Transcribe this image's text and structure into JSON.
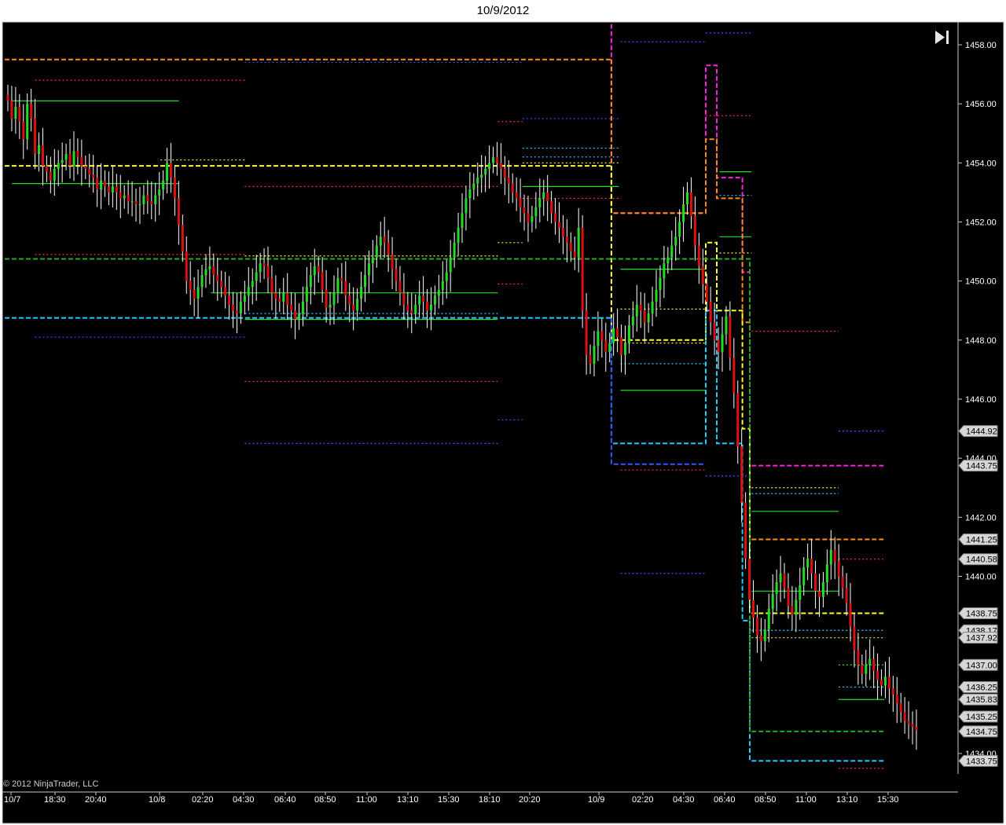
{
  "window": {
    "title": "10/9/2012"
  },
  "copyright": "© 2012 NinjaTrader, LLC",
  "chart_data": {
    "type": "candlestick",
    "title": "10/9/2012",
    "background": "#000000",
    "up_color": "#22dd22",
    "down_color": "#dd1111",
    "wick_color": "#ffffff",
    "ylim": [
      1433.0,
      1458.7
    ],
    "y_ticks": [
      "1458.00",
      "1456.00",
      "1454.00",
      "1452.00",
      "1450.00",
      "1448.00",
      "1446.00",
      "1444.00",
      "1442.00",
      "1440.00",
      "1434.00"
    ],
    "x_ticks": [
      "10/7",
      "18:30",
      "20:40",
      "10/8",
      "02:20",
      "04:30",
      "06:40",
      "08:50",
      "11:00",
      "13:10",
      "15:30",
      "18:10",
      "20:20",
      "10/9",
      "02:20",
      "04:30",
      "06:40",
      "08:50",
      "11:00",
      "13:10",
      "15:30"
    ],
    "price_markers": [
      {
        "label": "1444.92",
        "value": 1444.92
      },
      {
        "label": "1443.75",
        "value": 1443.75
      },
      {
        "label": "1441.25",
        "value": 1441.25
      },
      {
        "label": "1440.58",
        "value": 1440.58
      },
      {
        "label": "1438.75",
        "value": 1438.75
      },
      {
        "label": "1438.17",
        "value": 1438.17
      },
      {
        "label": "1437.92",
        "value": 1437.92
      },
      {
        "label": "1437.00",
        "value": 1437.0
      },
      {
        "label": "1436.25",
        "value": 1436.25
      },
      {
        "label": "1435.83",
        "value": 1435.83
      },
      {
        "label": "1435.25",
        "value": 1435.25
      },
      {
        "label": "1434.75",
        "value": 1434.75
      },
      {
        "label": "1433.75",
        "value": 1433.75
      }
    ],
    "closes": [
      1456.1,
      1455.5,
      1455.9,
      1455.4,
      1454.8,
      1456.0,
      1455.5,
      1454.3,
      1454.6,
      1453.9,
      1453.7,
      1453.4,
      1453.8,
      1454.0,
      1454.1,
      1454.3,
      1453.9,
      1454.4,
      1454.2,
      1453.9,
      1453.8,
      1453.6,
      1453.5,
      1453.1,
      1453.4,
      1453.2,
      1453.0,
      1453.2,
      1453.0,
      1452.8,
      1452.9,
      1452.7,
      1452.7,
      1452.6,
      1452.6,
      1452.9,
      1452.7,
      1452.6,
      1452.9,
      1453.1,
      1453.4,
      1454.0,
      1453.5,
      1452.8,
      1451.9,
      1451.0,
      1450.0,
      1449.7,
      1449.4,
      1449.8,
      1450.2,
      1450.4,
      1450.5,
      1450.2,
      1450.0,
      1449.8,
      1449.5,
      1449.2,
      1449.0,
      1448.9,
      1449.3,
      1449.5,
      1449.8,
      1450.0,
      1450.3,
      1450.6,
      1450.5,
      1450.1,
      1449.6,
      1449.4,
      1449.3,
      1449.6,
      1449.2,
      1449.0,
      1448.7,
      1448.9,
      1449.3,
      1449.8,
      1450.2,
      1450.5,
      1450.3,
      1449.7,
      1449.1,
      1449.2,
      1449.6,
      1450.1,
      1450.0,
      1449.5,
      1449.2,
      1449.0,
      1449.4,
      1449.8,
      1450.2,
      1450.6,
      1450.8,
      1451.2,
      1451.5,
      1451.3,
      1450.9,
      1450.4,
      1450.0,
      1449.6,
      1449.2,
      1449.0,
      1448.9,
      1449.2,
      1449.5,
      1449.3,
      1449.0,
      1449.2,
      1449.5,
      1449.7,
      1450.0,
      1450.3,
      1450.8,
      1451.3,
      1451.8,
      1452.3,
      1452.8,
      1453.1,
      1453.3,
      1453.5,
      1453.6,
      1453.8,
      1454.0,
      1454.2,
      1454.0,
      1453.8,
      1453.5,
      1453.3,
      1453.0,
      1452.8,
      1452.5,
      1452.3,
      1452.0,
      1452.2,
      1452.5,
      1452.8,
      1453.0,
      1452.7,
      1452.3,
      1452.0,
      1451.8,
      1451.5,
      1451.3,
      1451.0,
      1450.8,
      1451.8,
      1449.0,
      1447.5,
      1447.2,
      1447.8,
      1448.3,
      1448.0,
      1447.6,
      1447.9,
      1448.4,
      1448.1,
      1447.5,
      1447.9,
      1448.5,
      1448.8,
      1449.2,
      1449.0,
      1448.6,
      1448.9,
      1449.3,
      1449.7,
      1450.1,
      1450.6,
      1450.8,
      1451.2,
      1451.5,
      1452.0,
      1452.6,
      1453.0,
      1452.2,
      1451.2,
      1450.5,
      1449.9,
      1449.3,
      1448.6,
      1448.0,
      1447.6,
      1448.2,
      1448.8,
      1447.4,
      1446.2,
      1444.4,
      1442.5,
      1440.6,
      1439.2,
      1438.6,
      1438.0,
      1437.8,
      1438.2,
      1438.9,
      1439.4,
      1439.8,
      1440.1,
      1439.6,
      1439.0,
      1438.7,
      1439.2,
      1439.7,
      1440.3,
      1440.6,
      1440.1,
      1439.5,
      1439.3,
      1439.8,
      1440.4,
      1440.9,
      1440.5,
      1440.0,
      1439.6,
      1439.1,
      1438.3,
      1437.5,
      1437.0,
      1436.7,
      1437.0,
      1437.2,
      1436.8,
      1436.5,
      1436.3,
      1436.6,
      1436.2,
      1436.0,
      1435.7,
      1435.4,
      1435.1,
      1435.0,
      1434.9,
      1434.8
    ],
    "levels": [
      {
        "kind": "dash",
        "color": "#ff8c1a",
        "value": 1457.5,
        "x": [
          0,
          0.662
        ]
      },
      {
        "kind": "dash",
        "color": "#ffff33",
        "value": 1453.9,
        "x": [
          0,
          0.662
        ]
      },
      {
        "kind": "dash",
        "color": "#22aa22",
        "value": 1450.75,
        "x": [
          0,
          0.662
        ]
      },
      {
        "kind": "dash",
        "color": "#22ccff",
        "value": 1448.75,
        "x": [
          0,
          0.662
        ]
      },
      {
        "kind": "dot",
        "color": "#ff3333",
        "value": 1456.8,
        "x": [
          0.033,
          0.262
        ]
      },
      {
        "kind": "dot",
        "color": "#ff3333",
        "value": 1450.9,
        "x": [
          0.033,
          0.262
        ]
      },
      {
        "kind": "dot",
        "color": "#3355ff",
        "value": 1448.1,
        "x": [
          0.033,
          0.262
        ]
      },
      {
        "kind": "solid",
        "color": "#22dd22",
        "value": 1456.1,
        "x": [
          0.008,
          0.19
        ]
      },
      {
        "kind": "solid",
        "color": "#22dd22",
        "value": 1453.3,
        "x": [
          0.008,
          0.19
        ]
      },
      {
        "kind": "dot",
        "color": "#ffff33",
        "value": 1454.1,
        "x": [
          0.17,
          0.262
        ]
      },
      {
        "kind": "dot",
        "color": "#ffff33",
        "value": 1450.85,
        "x": [
          0.262,
          0.538
        ]
      },
      {
        "kind": "dot",
        "color": "#ff3333",
        "value": 1453.2,
        "x": [
          0.262,
          0.538
        ]
      },
      {
        "kind": "dot",
        "color": "#ff3333",
        "value": 1446.6,
        "x": [
          0.262,
          0.538
        ]
      },
      {
        "kind": "dot",
        "color": "#3355ff",
        "value": 1444.5,
        "x": [
          0.262,
          0.538
        ]
      },
      {
        "kind": "dot",
        "color": "#33ccff",
        "value": 1448.9,
        "x": [
          0.262,
          0.538
        ]
      },
      {
        "kind": "solid",
        "color": "#22dd22",
        "value": 1449.6,
        "x": [
          0.225,
          0.538
        ]
      },
      {
        "kind": "solid",
        "color": "#22dd22",
        "value": 1448.7,
        "x": [
          0.262,
          0.538
        ]
      },
      {
        "kind": "dot",
        "color": "#3355ff",
        "value": 1457.4,
        "x": [
          0.262,
          0.565
        ]
      },
      {
        "kind": "dot",
        "color": "#ff3333",
        "value": 1455.4,
        "x": [
          0.538,
          0.565
        ]
      },
      {
        "kind": "dot",
        "color": "#3355ff",
        "value": 1455.5,
        "x": [
          0.565,
          0.67
        ]
      },
      {
        "kind": "dot",
        "color": "#33ccff",
        "value": 1454.5,
        "x": [
          0.565,
          0.67
        ]
      },
      {
        "kind": "dot",
        "color": "#33ccff",
        "value": 1454.2,
        "x": [
          0.565,
          0.67
        ]
      },
      {
        "kind": "dot",
        "color": "#ffff33",
        "value": 1454.0,
        "x": [
          0.565,
          0.67
        ]
      },
      {
        "kind": "dot",
        "color": "#ff3333",
        "value": 1452.8,
        "x": [
          0.565,
          0.67
        ]
      },
      {
        "kind": "solid",
        "color": "#22dd22",
        "value": 1453.2,
        "x": [
          0.565,
          0.67
        ]
      },
      {
        "kind": "dot",
        "color": "#ffff33",
        "value": 1451.3,
        "x": [
          0.538,
          0.565
        ]
      },
      {
        "kind": "dot",
        "color": "#ff3333",
        "value": 1449.9,
        "x": [
          0.538,
          0.565
        ]
      },
      {
        "kind": "dot",
        "color": "#3355ff",
        "value": 1445.3,
        "x": [
          0.538,
          0.565
        ]
      },
      {
        "kind": "dot",
        "color": "#3355ff",
        "value": 1458.1,
        "x": [
          0.672,
          0.765
        ]
      },
      {
        "kind": "dot",
        "color": "#3355ff",
        "value": 1458.4,
        "x": [
          0.765,
          0.815
        ]
      },
      {
        "kind": "dot",
        "color": "#ff3333",
        "value": 1455.6,
        "x": [
          0.765,
          0.815
        ]
      },
      {
        "kind": "dot",
        "color": "#ffff33",
        "value": 1449.05,
        "x": [
          0.672,
          0.765
        ]
      },
      {
        "kind": "dot",
        "color": "#ffff33",
        "value": 1447.9,
        "x": [
          0.672,
          0.765
        ]
      },
      {
        "kind": "dot",
        "color": "#33ccff",
        "value": 1447.2,
        "x": [
          0.672,
          0.765
        ]
      },
      {
        "kind": "solid",
        "color": "#22dd22",
        "value": 1450.4,
        "x": [
          0.672,
          0.765
        ]
      },
      {
        "kind": "solid",
        "color": "#22dd22",
        "value": 1446.3,
        "x": [
          0.672,
          0.765
        ]
      },
      {
        "kind": "dot",
        "color": "#3355ff",
        "value": 1440.1,
        "x": [
          0.672,
          0.765
        ]
      },
      {
        "kind": "dot",
        "color": "#3355ff",
        "value": 1443.4,
        "x": [
          0.765,
          0.815
        ]
      },
      {
        "kind": "dot",
        "color": "#ff3333",
        "value": 1443.6,
        "x": [
          0.672,
          0.765
        ]
      },
      {
        "kind": "dot",
        "color": "#33ccff",
        "value": 1452.9,
        "x": [
          0.78,
          0.815
        ]
      },
      {
        "kind": "solid",
        "color": "#22dd22",
        "value": 1453.7,
        "x": [
          0.78,
          0.815
        ]
      },
      {
        "kind": "solid",
        "color": "#22dd22",
        "value": 1451.5,
        "x": [
          0.78,
          0.815
        ]
      },
      {
        "kind": "dot",
        "color": "#ffff33",
        "value": 1450.95,
        "x": [
          0.78,
          0.815
        ]
      },
      {
        "kind": "dot",
        "color": "#ff3333",
        "value": 1448.3,
        "x": [
          0.815,
          0.91
        ]
      },
      {
        "kind": "dot",
        "color": "#ffff33",
        "value": 1443.0,
        "x": [
          0.815,
          0.91
        ]
      },
      {
        "kind": "dot",
        "color": "#33ccff",
        "value": 1442.8,
        "x": [
          0.815,
          0.91
        ]
      },
      {
        "kind": "solid",
        "color": "#22dd22",
        "value": 1442.2,
        "x": [
          0.815,
          0.91
        ]
      },
      {
        "kind": "solid",
        "color": "#22dd22",
        "value": 1439.5,
        "x": [
          0.815,
          0.91
        ]
      },
      {
        "kind": "dash",
        "color": "#ff8c1a",
        "value": 1441.25,
        "x": [
          0.815,
          0.96
        ]
      },
      {
        "kind": "dot",
        "color": "#ff3333",
        "value": 1440.58,
        "x": [
          0.91,
          0.96
        ]
      },
      {
        "kind": "dash",
        "color": "#ffff33",
        "value": 1438.75,
        "x": [
          0.815,
          0.96
        ]
      },
      {
        "kind": "dot",
        "color": "#33ccff",
        "value": 1438.17,
        "x": [
          0.815,
          0.96
        ]
      },
      {
        "kind": "dot",
        "color": "#ffff33",
        "value": 1437.92,
        "x": [
          0.815,
          0.96
        ]
      },
      {
        "kind": "dot",
        "color": "#22dd22",
        "value": 1437.0,
        "x": [
          0.91,
          0.96
        ]
      },
      {
        "kind": "dot",
        "color": "#33ccff",
        "value": 1436.25,
        "x": [
          0.91,
          0.96
        ]
      },
      {
        "kind": "solid",
        "color": "#22dd22",
        "value": 1435.83,
        "x": [
          0.91,
          0.96
        ]
      },
      {
        "kind": "dash",
        "color": "#22aa22",
        "value": 1434.75,
        "x": [
          0.815,
          0.96
        ]
      },
      {
        "kind": "dash",
        "color": "#22ccff",
        "value": 1433.75,
        "x": [
          0.815,
          0.96
        ]
      },
      {
        "kind": "dot",
        "color": "#3355ff",
        "value": 1444.92,
        "x": [
          0.91,
          0.96
        ]
      },
      {
        "kind": "dash",
        "color": "#ff22dd",
        "value": 1443.75,
        "x": [
          0.815,
          0.96
        ]
      },
      {
        "kind": "dot",
        "color": "#ff3333",
        "value": 1433.5,
        "x": [
          0.91,
          0.96
        ]
      }
    ],
    "steps": [
      {
        "color": "#ff22dd",
        "points": [
          [
            0.662,
            1458.7
          ],
          [
            0.662,
            1452.3
          ],
          [
            0.765,
            1452.3
          ],
          [
            0.765,
            1457.3
          ],
          [
            0.777,
            1457.3
          ],
          [
            0.777,
            1453.5
          ],
          [
            0.805,
            1453.5
          ],
          [
            0.805,
            1450.3
          ],
          [
            0.813,
            1450.3
          ],
          [
            0.813,
            1443.75
          ]
        ]
      },
      {
        "color": "#ff8c1a",
        "points": [
          [
            0.662,
            1457.5
          ],
          [
            0.662,
            1452.3
          ],
          [
            0.765,
            1452.3
          ],
          [
            0.765,
            1454.8
          ],
          [
            0.777,
            1454.8
          ],
          [
            0.777,
            1452.8
          ],
          [
            0.805,
            1452.8
          ],
          [
            0.805,
            1448.6
          ],
          [
            0.813,
            1448.6
          ],
          [
            0.813,
            1441.25
          ]
        ]
      },
      {
        "color": "#ffff33",
        "points": [
          [
            0.662,
            1453.9
          ],
          [
            0.662,
            1448.0
          ],
          [
            0.765,
            1448.0
          ],
          [
            0.765,
            1451.3
          ],
          [
            0.777,
            1451.3
          ],
          [
            0.777,
            1449.0
          ],
          [
            0.805,
            1449.0
          ],
          [
            0.805,
            1445.0
          ],
          [
            0.813,
            1445.0
          ],
          [
            0.813,
            1438.75
          ]
        ]
      },
      {
        "color": "#22ccff",
        "points": [
          [
            0.662,
            1448.75
          ],
          [
            0.662,
            1444.5
          ],
          [
            0.765,
            1444.5
          ],
          [
            0.765,
            1449.0
          ],
          [
            0.777,
            1449.0
          ],
          [
            0.777,
            1444.5
          ],
          [
            0.805,
            1444.5
          ],
          [
            0.805,
            1438.5
          ],
          [
            0.813,
            1438.5
          ],
          [
            0.813,
            1433.75
          ]
        ]
      },
      {
        "color": "#3355ff",
        "points": [
          [
            0.662,
            1448.75
          ],
          [
            0.662,
            1443.8
          ],
          [
            0.765,
            1443.8
          ]
        ]
      },
      {
        "color": "#22aa22",
        "points": [
          [
            0.662,
            1450.75
          ],
          [
            0.662,
            1450.75
          ],
          [
            0.813,
            1450.75
          ],
          [
            0.813,
            1434.75
          ]
        ]
      }
    ]
  }
}
